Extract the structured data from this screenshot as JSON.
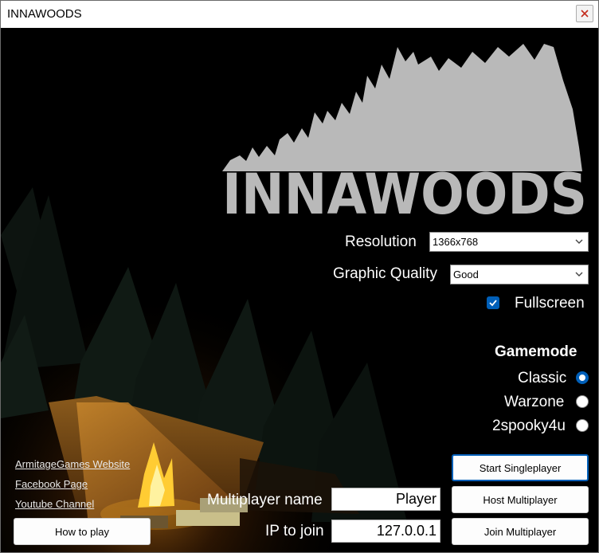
{
  "window": {
    "title": "INNAWOODS"
  },
  "logo": {
    "text": "INNAWOODS"
  },
  "settings": {
    "resolution_label": "Resolution",
    "resolution_value": "1366x768",
    "quality_label": "Graphic Quality",
    "quality_value": "Good",
    "fullscreen_label": "Fullscreen",
    "fullscreen_checked": true
  },
  "gamemode": {
    "title": "Gamemode",
    "options": [
      {
        "label": "Classic",
        "selected": true
      },
      {
        "label": "Warzone",
        "selected": false
      },
      {
        "label": "2spooky4u",
        "selected": false
      }
    ]
  },
  "links": {
    "website": "ArmitageGames Website",
    "facebook": "Facebook Page",
    "youtube": "Youtube Channel"
  },
  "buttons": {
    "how_to_play": "How to play",
    "start_single": "Start Singleplayer",
    "host_multi": "Host Multiplayer",
    "join_multi": "Join Multiplayer"
  },
  "multiplayer": {
    "name_label": "Multiplayer name",
    "name_value": "Player",
    "ip_label": "IP to join",
    "ip_value": "127.0.0.1"
  },
  "colors": {
    "accent": "#005fb8",
    "logo": "#b9b9b9",
    "fire": "#ffb020"
  }
}
